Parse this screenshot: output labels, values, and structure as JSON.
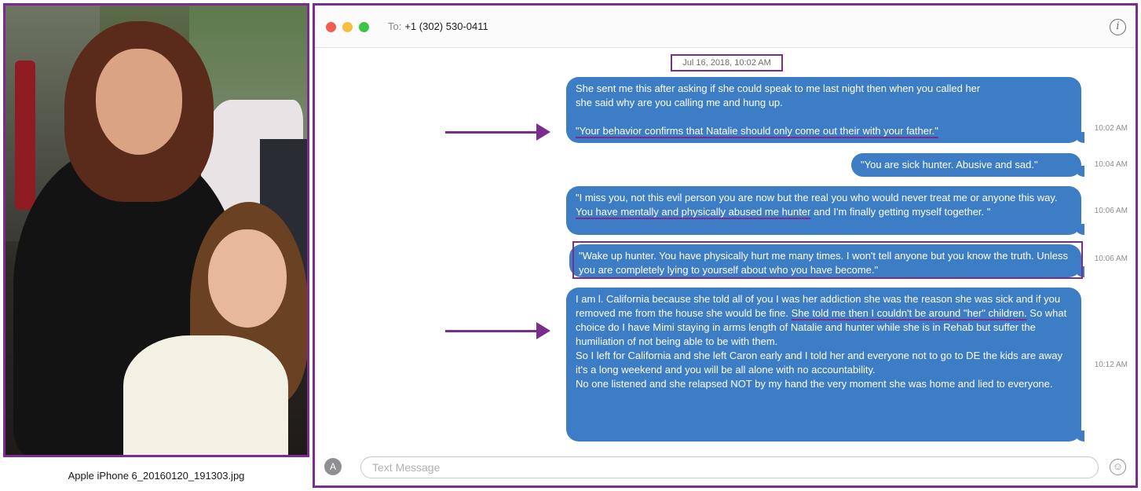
{
  "photo": {
    "caption": "Apple iPhone 6_20160120_191303.jpg"
  },
  "window": {
    "to_label": "To:",
    "recipient": "+1 (302) 530-0411",
    "info_icon": "info-icon"
  },
  "conversation": {
    "date_header": "Jul 16, 2018, 10:02 AM",
    "messages": [
      {
        "line1": "She sent me this after asking if she could speak to me last night then when you called her",
        "line2": "she said why are you calling me and hung up.",
        "quote": "\"Your behavior confirms that Natalie should only come out their with your father.\"",
        "time": "10:02 AM"
      },
      {
        "text": "\"You are sick hunter. Abusive and sad.\"",
        "time": "10:04 AM"
      },
      {
        "part1": "\"I miss you, not this evil person you are now but the real you who would never treat me or anyone this way. ",
        "underlined": "You have mentally and physically abused me hunter",
        "part2": " and I'm finally getting myself together. \"",
        "time": "10:06 AM"
      },
      {
        "text": "\"Wake up hunter. You have physically hurt me many times. I won't tell anyone but you know the truth. Unless you are completely lying to yourself about who you have become.\"",
        "time": "10:06 AM"
      },
      {
        "part1": "I am l. California because she told all of you I was her addiction she was the reason she was sick and if you removed me from the house she would be fine. ",
        "underlined": "She told me then I couldn't be around \"her\" children.",
        "part2": " So what choice do I have Mimi staying in arms length of Natalie and hunter while she is in Rehab but suffer the humiliation of not being able to be with them.",
        "para2": "So I left for California and she left Caron early and I told her and everyone not to go to DE the kids are away it's a long weekend and you will be all alone with no accountability.",
        "para3": "No one listened and she relapsed NOT by my hand the very moment she was home and lied to everyone.",
        "time": "10:12 AM"
      }
    ]
  },
  "input": {
    "placeholder": "Text Message",
    "value": ""
  },
  "colors": {
    "annotation": "#7b2d8e",
    "bubble": "#3c7dc6"
  }
}
